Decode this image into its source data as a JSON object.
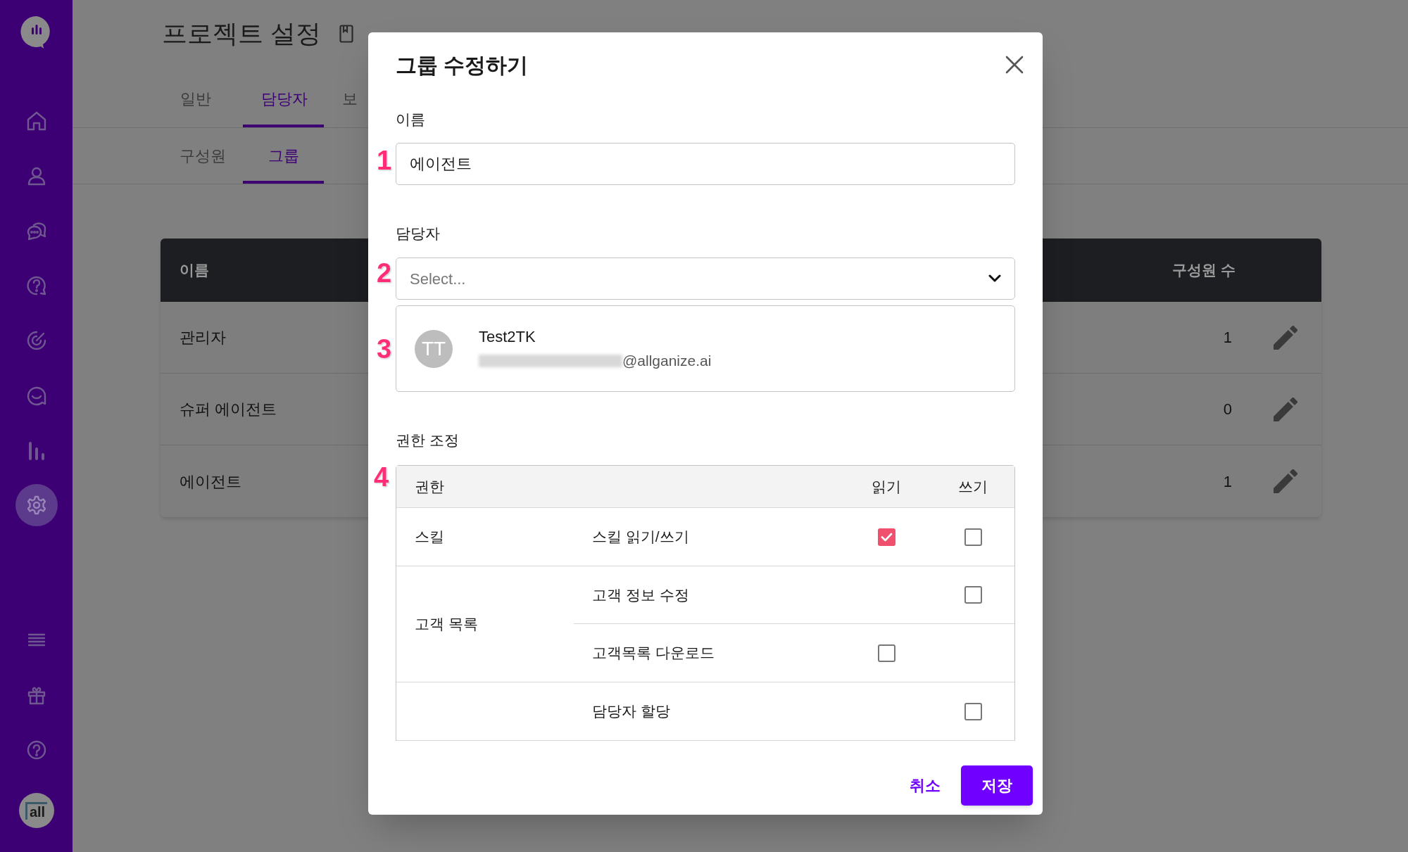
{
  "sidebar": {
    "logo": {
      "kind": "logo"
    },
    "items": [
      {
        "kind": "home",
        "selected": false
      },
      {
        "kind": "user",
        "selected": false
      },
      {
        "kind": "chat",
        "selected": false
      },
      {
        "kind": "help-refresh",
        "selected": false
      },
      {
        "kind": "radar",
        "selected": false
      },
      {
        "kind": "smile-chat",
        "selected": false
      },
      {
        "kind": "bar-chart",
        "selected": false
      },
      {
        "kind": "settings",
        "selected": true
      }
    ],
    "bottom_items": [
      {
        "kind": "list"
      },
      {
        "kind": "gift"
      },
      {
        "kind": "help"
      }
    ],
    "account": {
      "initials": "all"
    }
  },
  "page": {
    "title": "프로젝트 설정",
    "tabs": [
      {
        "label": "일반",
        "selected": false
      },
      {
        "label": "담당자",
        "selected": true
      },
      {
        "label": "보",
        "selected": false
      }
    ],
    "subtabs": [
      {
        "label": "구성원",
        "selected": false
      },
      {
        "label": "그룹",
        "selected": true
      }
    ],
    "table": {
      "columns": [
        "이름",
        "구성원 수"
      ],
      "rows": [
        {
          "name": "관리자",
          "members": "1"
        },
        {
          "name": "슈퍼 에이전트",
          "members": "0"
        },
        {
          "name": "에이전트",
          "members": "1"
        }
      ]
    }
  },
  "modal": {
    "title": "그룹 수정하기",
    "name_label": "이름",
    "name_value": "에이전트",
    "assignee_label": "담당자",
    "assignee_placeholder": "Select...",
    "assignees": [
      {
        "initials": "TT",
        "name": "Test2TK",
        "email": "@allganize.ai"
      }
    ],
    "permissions_label": "권한 조정",
    "permissions": {
      "columns": [
        "권한",
        "읽기",
        "쓰기"
      ],
      "groups": [
        {
          "category": "스킬",
          "items": [
            {
              "label": "스킬 읽기/쓰기",
              "read": true,
              "write": false
            }
          ]
        },
        {
          "category": "고객 목록",
          "items": [
            {
              "label": "고객 정보 수정",
              "write": false
            },
            {
              "label": "고객목록 다운로드",
              "read": false
            }
          ]
        },
        {
          "items": [
            {
              "label": "담당자 할당",
              "write": false
            }
          ]
        }
      ]
    },
    "cancel": "취소",
    "save": "저장"
  },
  "annotations": [
    "1",
    "2",
    "3",
    "4"
  ]
}
